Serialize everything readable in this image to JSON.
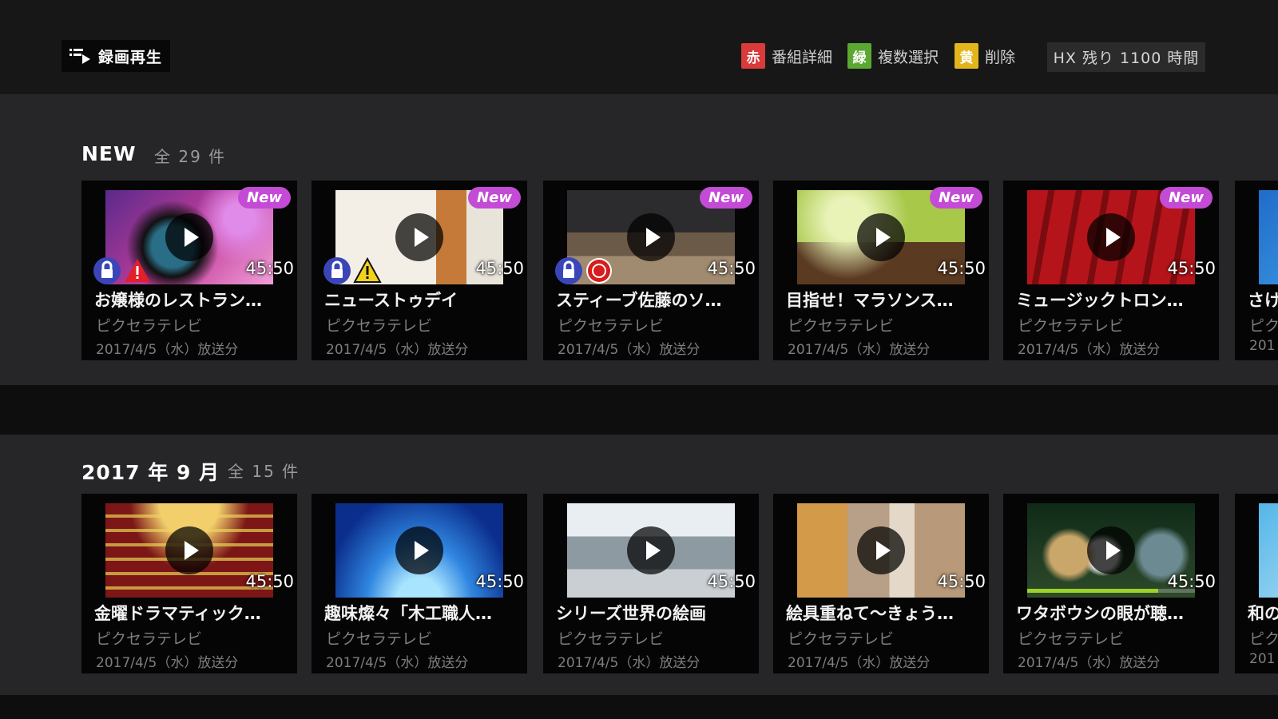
{
  "header": {
    "app_title": "録画再生",
    "legend": [
      {
        "key": "赤",
        "label": "番組詳細",
        "color": "#d93a3a"
      },
      {
        "key": "緑",
        "label": "複数選択",
        "color": "#5aa832"
      },
      {
        "key": "黄",
        "label": "削除",
        "color": "#e3b51d"
      }
    ],
    "storage": "HX 残り 1100 時間"
  },
  "sections": [
    {
      "title": "NEW",
      "count": "全 29 件",
      "cards": [
        {
          "title": "お嬢様のレストラン…",
          "channel": "ピクセラテレビ",
          "date": "2017/4/5（水）放送分",
          "duration": "45:50",
          "badge": "New"
        },
        {
          "title": "ニューストゥデイ",
          "channel": "ピクセラテレビ",
          "date": "2017/4/5（水）放送分",
          "duration": "45:50",
          "badge": "New"
        },
        {
          "title": "スティーブ佐藤のソ…",
          "channel": "ピクセラテレビ",
          "date": "2017/4/5（水）放送分",
          "duration": "45:50",
          "badge": "New"
        },
        {
          "title": "目指せ！マラソンス…",
          "channel": "ピクセラテレビ",
          "date": "2017/4/5（水）放送分",
          "duration": "45:50",
          "badge": "New"
        },
        {
          "title": "ミュージックトロン…",
          "channel": "ピクセラテレビ",
          "date": "2017/4/5（水）放送分",
          "duration": "45:50",
          "badge": "New"
        },
        {
          "title": "さけ",
          "channel": "ピク",
          "date": "201"
        }
      ]
    },
    {
      "title": "2017 年 9 月",
      "count": "全 15 件",
      "cards": [
        {
          "title": "金曜ドラマティック…",
          "channel": "ピクセラテレビ",
          "date": "2017/4/5（水）放送分",
          "duration": "45:50"
        },
        {
          "title": "趣味燦々「木工職人…",
          "channel": "ピクセラテレビ",
          "date": "2017/4/5（水）放送分",
          "duration": "45:50"
        },
        {
          "title": "シリーズ世界の絵画",
          "channel": "ピクセラテレビ",
          "date": "2017/4/5（水）放送分",
          "duration": "45:50"
        },
        {
          "title": "絵具重ねて～きょう…",
          "channel": "ピクセラテレビ",
          "date": "2017/4/5（水）放送分",
          "duration": "45:50"
        },
        {
          "title": "ワタボウシの眼が聴…",
          "channel": "ピクセラテレビ",
          "date": "2017/4/5（水）放送分",
          "duration": "45:50",
          "progress": 0.78
        },
        {
          "title": "和の",
          "channel": "ピク",
          "date": "201"
        }
      ]
    }
  ]
}
